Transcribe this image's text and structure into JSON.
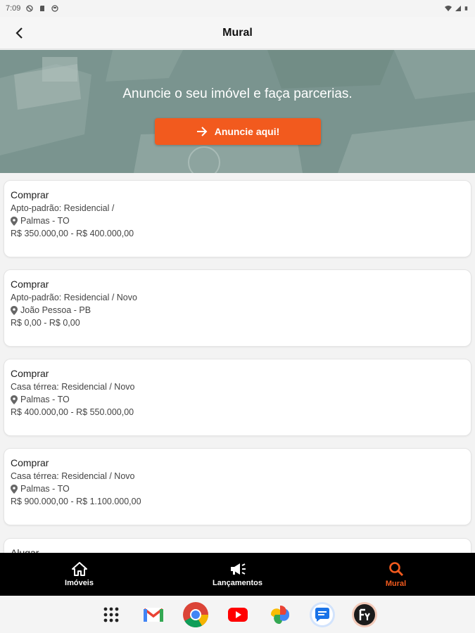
{
  "status_bar": {
    "time": "7:09"
  },
  "app_bar": {
    "title": "Mural"
  },
  "banner": {
    "headline": "Anuncie o seu imóvel e faça parcerias.",
    "cta_label": "Anuncie aqui!"
  },
  "listings": [
    {
      "type": "Comprar",
      "category": "Apto-padrão: Residencial /",
      "location": "Palmas - TO",
      "price": "R$ 350.000,00 - R$ 400.000,00"
    },
    {
      "type": "Comprar",
      "category": "Apto-padrão: Residencial / Novo",
      "location": "João Pessoa - PB",
      "price": "R$ 0,00 - R$ 0,00"
    },
    {
      "type": "Comprar",
      "category": "Casa térrea: Residencial / Novo",
      "location": "Palmas - TO",
      "price": "R$ 400.000,00 - R$ 550.000,00"
    },
    {
      "type": "Comprar",
      "category": "Casa térrea: Residencial / Novo",
      "location": "Palmas - TO",
      "price": "R$ 900.000,00 - R$ 1.100.000,00"
    },
    {
      "type": "Alugar"
    }
  ],
  "bottom_nav": {
    "items": [
      {
        "label": "Imóveis",
        "icon": "home-icon"
      },
      {
        "label": "Lançamentos",
        "icon": "megaphone-icon"
      },
      {
        "label": "Mural",
        "icon": "search-icon"
      }
    ],
    "active_label": "Mural"
  },
  "taskbar": {
    "apps": [
      "app-grid-icon",
      "gmail-icon",
      "chrome-icon",
      "youtube-icon",
      "photos-icon",
      "messages-icon",
      "fy-app-icon"
    ]
  },
  "colors": {
    "accent": "#f25a1e",
    "banner": "#7f9893",
    "nav_bg": "#000000"
  }
}
